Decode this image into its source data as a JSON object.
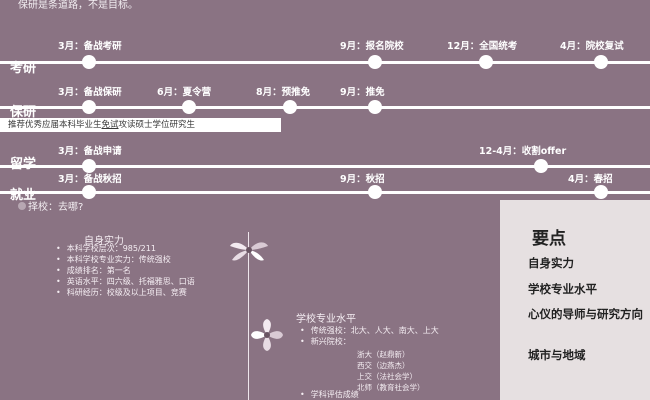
{
  "header": {
    "note": "保研是条道路，不是目标。"
  },
  "tracks": {
    "kaoyan": {
      "label": "考研",
      "events": [
        "3月：备战考研",
        "9月：报名院校",
        "12月：全国统考",
        "4月：院校复试"
      ]
    },
    "baoyan": {
      "label": "保研",
      "events": [
        "3月：备战保研",
        "6月：夏令营",
        "8月：预推免",
        "9月：推免"
      ],
      "tooltip_before": "推荐优秀应届本科毕业生",
      "tooltip_underlined": "免试",
      "tooltip_after": "攻读硕士学位研究生"
    },
    "liuxue": {
      "label": "留学",
      "events": [
        "3月：备战申请",
        "12-4月：收割offer"
      ]
    },
    "jiuye": {
      "label": "就业",
      "events": [
        "3月：备战秋招",
        "9月：秋招",
        "4月：春招"
      ]
    }
  },
  "choose": {
    "text": "择校：去哪?"
  },
  "self_strength": {
    "title": "自身实力",
    "items": [
      "本科学校层次：985/211",
      "本科学校专业实力：传统强校",
      "成绩排名：第一名",
      "英语水平：四六级、托福雅思、口语",
      "科研经历：校级及以上项目、竞赛"
    ]
  },
  "school_major": {
    "title": "学校专业水平",
    "items": [
      "传统强校：北大、人大、南大、上大",
      "新兴院校："
    ],
    "subitems": [
      "浙大（赵鼎新）",
      "西交（边燕杰）",
      "上交（法社会学）",
      "北师（教育社会学）"
    ],
    "more": "学科评估成绩"
  },
  "key_points": {
    "heading": "要点",
    "items": [
      "自身实力",
      "学校专业水平",
      "心仪的导师与研究方向",
      "城市与地域"
    ]
  },
  "colors": {
    "background": "#8a7383",
    "panel": "#e6e0e1",
    "accent": "#ffffff"
  }
}
